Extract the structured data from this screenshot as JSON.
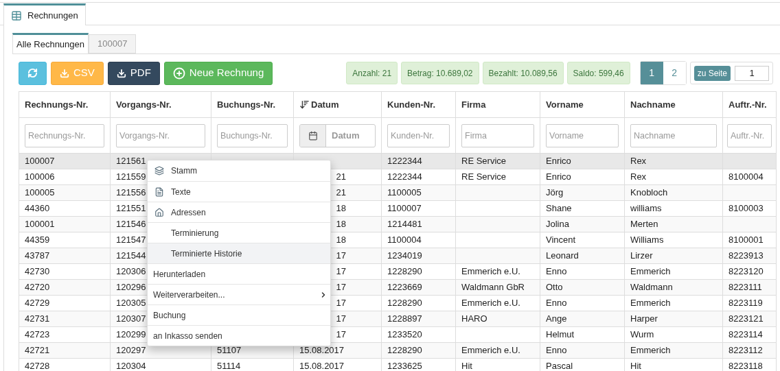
{
  "outer_tab": {
    "label": "Rechnungen"
  },
  "tabs": [
    {
      "label": "Alle Rechnungen",
      "selected": true
    },
    {
      "label": "100007",
      "selected": false
    }
  ],
  "toolbar": [
    {
      "kind": "refresh"
    },
    {
      "kind": "csv",
      "label": "CSV"
    },
    {
      "kind": "pdf",
      "label": "PDF"
    },
    {
      "kind": "new",
      "label": "Neue Rechnung"
    }
  ],
  "summary": [
    "Anzahl: 21",
    "Betrag: 10.689,02",
    "Bezahlt: 10.089,56",
    "Saldo: 599,46"
  ],
  "pagination": {
    "pages": [
      {
        "label": "1",
        "selected": true
      },
      {
        "label": "2",
        "selected": false
      }
    ],
    "goto_label": "zu Seite",
    "goto_value": "1"
  },
  "table": {
    "columns": [
      {
        "label": "Rechnungs-Nr.",
        "placeholder": "Rechnungs-Nr.",
        "sorted": false,
        "kind": "text"
      },
      {
        "label": "Vorgangs-Nr.",
        "placeholder": "Vorgangs-Nr.",
        "sorted": false,
        "kind": "text"
      },
      {
        "label": "Buchungs-Nr.",
        "placeholder": "Buchungs-Nr.",
        "sorted": false,
        "kind": "text"
      },
      {
        "label": "Datum",
        "placeholder": "Datum",
        "sorted": true,
        "kind": "date"
      },
      {
        "label": "Kunden-Nr.",
        "placeholder": "Kunden-Nr.",
        "sorted": false,
        "kind": "text"
      },
      {
        "label": "Firma",
        "placeholder": "Firma",
        "sorted": false,
        "kind": "text"
      },
      {
        "label": "Vorname",
        "placeholder": "Vorname",
        "sorted": false,
        "kind": "text"
      },
      {
        "label": "Nachname",
        "placeholder": "Nachname",
        "sorted": false,
        "kind": "text"
      },
      {
        "label": "Auftr.-Nr.",
        "placeholder": "Auftr.-Nr.",
        "sorted": false,
        "kind": "text"
      }
    ],
    "rows": [
      {
        "selected": true,
        "cells": [
          "100007",
          "121561",
          null,
          null,
          "1222344",
          "RE Service",
          "Enrico",
          "Rex",
          ""
        ]
      },
      {
        "selected": false,
        "cells": [
          "100006",
          "121559",
          null,
          {
            "text": "21",
            "cut": true
          },
          "1222344",
          "RE Service",
          "Enrico",
          "Rex",
          "8100004"
        ]
      },
      {
        "selected": false,
        "cells": [
          "100005",
          "121556",
          null,
          {
            "text": "21",
            "cut": true
          },
          "1100005",
          "",
          "Jörg",
          "Knobloch",
          ""
        ]
      },
      {
        "selected": false,
        "cells": [
          "44360",
          "121551",
          null,
          {
            "text": "18",
            "cut": true
          },
          "1100007",
          "",
          "Shane",
          "williams",
          "8100003"
        ]
      },
      {
        "selected": false,
        "cells": [
          "100001",
          "121546",
          null,
          {
            "text": "18",
            "cut": true
          },
          "1214481",
          "",
          "Jolina",
          "Merten",
          ""
        ]
      },
      {
        "selected": false,
        "cells": [
          "44359",
          "121547",
          null,
          {
            "text": "18",
            "cut": true
          },
          "1100004",
          "",
          "Vincent",
          "Williams",
          "8100001"
        ]
      },
      {
        "selected": false,
        "cells": [
          "43787",
          "121544",
          null,
          {
            "text": "17",
            "cut": true
          },
          "1234019",
          "",
          "Leonard",
          "Lirzer",
          "8223913"
        ]
      },
      {
        "selected": false,
        "cells": [
          "42730",
          "120306",
          null,
          {
            "text": "17",
            "cut": true
          },
          "1228290",
          "Emmerich e.U.",
          "Enno",
          "Emmerich",
          "8223120"
        ]
      },
      {
        "selected": false,
        "cells": [
          "42720",
          "120296",
          null,
          {
            "text": "17",
            "cut": true
          },
          "1223669",
          "Waldmann GbR",
          "Otto",
          "Waldmann",
          "8223111"
        ]
      },
      {
        "selected": false,
        "cells": [
          "42729",
          "120305",
          null,
          {
            "text": "17",
            "cut": true
          },
          "1228290",
          "Emmerich e.U.",
          "Enno",
          "Emmerich",
          "8223119"
        ]
      },
      {
        "selected": false,
        "cells": [
          "42731",
          "120307",
          null,
          {
            "text": "17",
            "cut": true
          },
          "1228897",
          "HARO",
          "Ange",
          "Harper",
          "8223121"
        ]
      },
      {
        "selected": false,
        "cells": [
          "42723",
          "120299",
          null,
          {
            "text": "17",
            "cut": true
          },
          "1233520",
          "",
          "Helmut",
          "Wurm",
          "8223114"
        ]
      },
      {
        "selected": false,
        "cells": [
          "42721",
          "120297",
          "51107",
          "15.08.2017",
          "1228290",
          "Emmerich e.U.",
          "Enno",
          "Emmerich",
          "8223112"
        ]
      },
      {
        "selected": false,
        "cells": [
          "42728",
          "120304",
          "51114",
          "15.08.2017",
          "1233625",
          "Hit",
          "Pascal",
          "Hit",
          "8223118"
        ]
      }
    ]
  },
  "context_menu": [
    {
      "label": "Stamm",
      "kind": "indented",
      "selected": false,
      "submenu": false
    },
    {
      "label": "Texte",
      "kind": "indented",
      "selected": false,
      "submenu": false
    },
    {
      "label": "Adressen",
      "kind": "indented",
      "selected": false,
      "submenu": false
    },
    {
      "label": "Terminierung",
      "kind": "indented",
      "selected": false,
      "submenu": false
    },
    {
      "label": "Terminierte Historie",
      "kind": "indented",
      "selected": true,
      "submenu": false
    },
    {
      "label": "Herunterladen",
      "kind": "plain",
      "selected": false,
      "submenu": false
    },
    {
      "label": "Weiterverarbeiten...",
      "kind": "plain",
      "selected": false,
      "submenu": true
    },
    {
      "label": "Buchung",
      "kind": "plain",
      "selected": false,
      "submenu": false
    },
    {
      "label": "an Inkasso senden",
      "kind": "plain",
      "selected": false,
      "submenu": false
    }
  ]
}
